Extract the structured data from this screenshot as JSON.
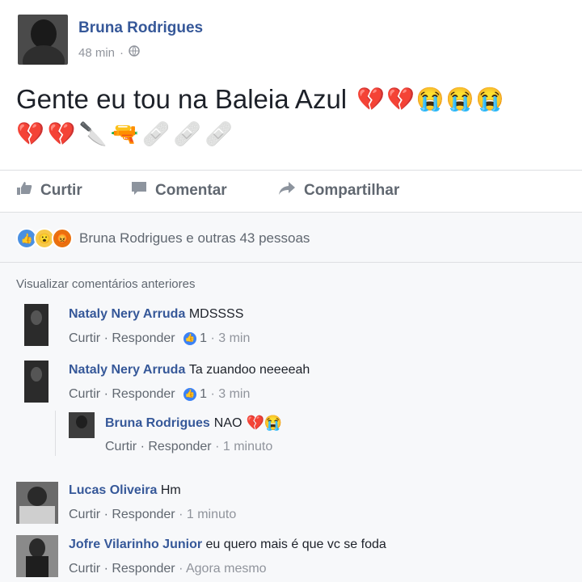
{
  "post": {
    "author": "Bruna Rodrigues",
    "time": "48 min",
    "privacy_icon": "globe-icon",
    "text": "Gente eu tou na Baleia Azul",
    "emojis_line1": [
      "💔",
      "💔",
      "😭",
      "😭",
      "😭"
    ],
    "emojis_line2": [
      "💔",
      "💔",
      "🔪",
      "🔫",
      "🩹",
      "🩹",
      "🩹"
    ]
  },
  "actions": {
    "like": "Curtir",
    "comment": "Comentar",
    "share": "Compartilhar"
  },
  "reactions": {
    "icons": [
      "like-icon",
      "wow-icon",
      "angry-icon"
    ],
    "summary": "Bruna Rodrigues e outras 43 pessoas"
  },
  "comments_header": "Visualizar comentários anteriores",
  "comments": [
    {
      "name": "Nataly Nery Arruda",
      "text": "MDSSSS",
      "like": "Curtir",
      "reply": "Responder",
      "likes": "1",
      "time": "3 min"
    },
    {
      "name": "Nataly Nery Arruda",
      "text": "Ta zuandoo neeeeah",
      "like": "Curtir",
      "reply": "Responder",
      "likes": "1",
      "time": "3 min"
    },
    {
      "name": "Bruna Rodrigues",
      "text": "NAO",
      "emojis": "💔😭",
      "like": "Curtir",
      "reply": "Responder",
      "time": "1 minuto"
    },
    {
      "name": "Lucas Oliveira",
      "text": "Hm",
      "like": "Curtir",
      "reply": "Responder",
      "time": "1 minuto"
    },
    {
      "name": "Jofre Vilarinho Junior",
      "text": "eu quero mais é que vc se foda",
      "like": "Curtir",
      "reply": "Responder",
      "time": "Agora mesmo"
    }
  ],
  "colors": {
    "name_blue": "#365899",
    "meta_grey": "#90949c",
    "background": "#f7f8fa"
  }
}
